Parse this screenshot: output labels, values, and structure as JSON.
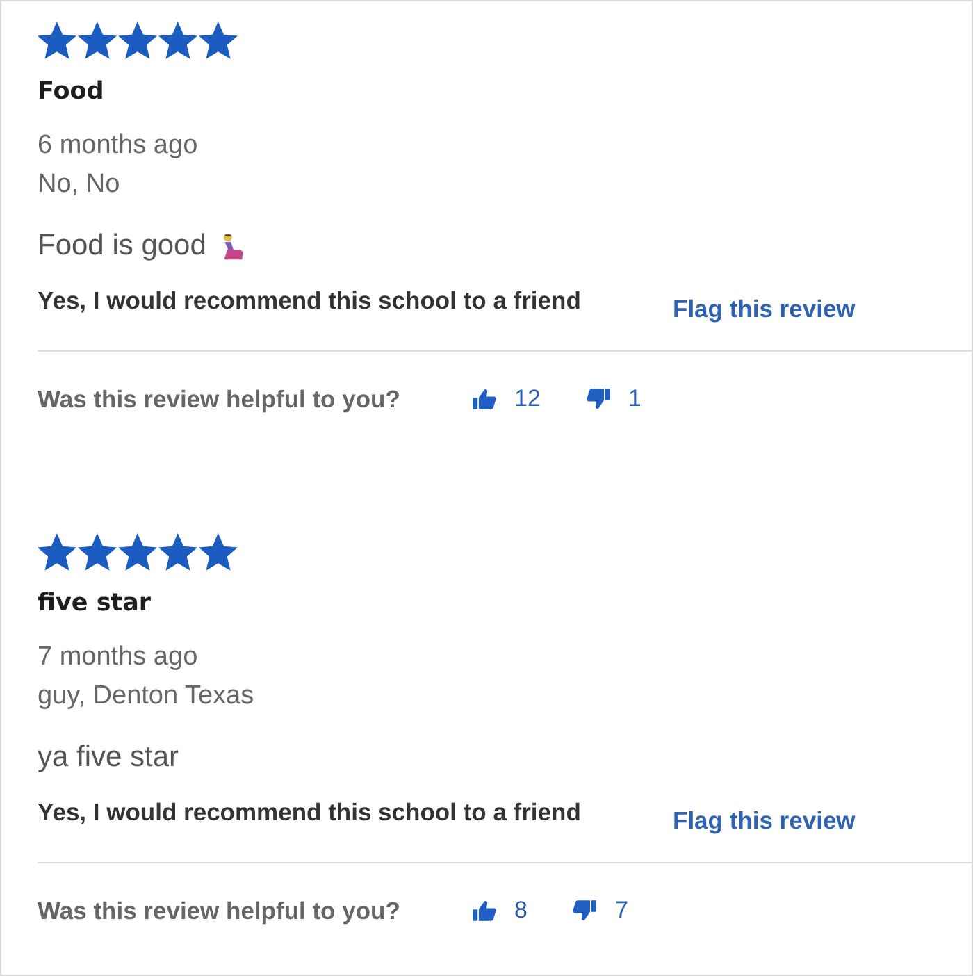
{
  "reviews": [
    {
      "stars": 5,
      "title": "Food",
      "time": "6 months ago",
      "author": "No, No",
      "body": "Food is good",
      "emoji": true,
      "recommendation": "Yes, I would recommend this school to a friend",
      "flag_link": "Flag this review",
      "helpful_prompt": "Was this review helpful to you?",
      "upvotes": "12",
      "downvotes": "1"
    },
    {
      "stars": 5,
      "title": "five star",
      "time": "7 months ago",
      "author": "guy, Denton Texas",
      "body": "ya five star",
      "emoji": false,
      "recommendation": "Yes, I would recommend this school to a friend",
      "flag_link": "Flag this review",
      "helpful_prompt": "Was this review helpful to you?",
      "upvotes": "8",
      "downvotes": "7"
    }
  ]
}
